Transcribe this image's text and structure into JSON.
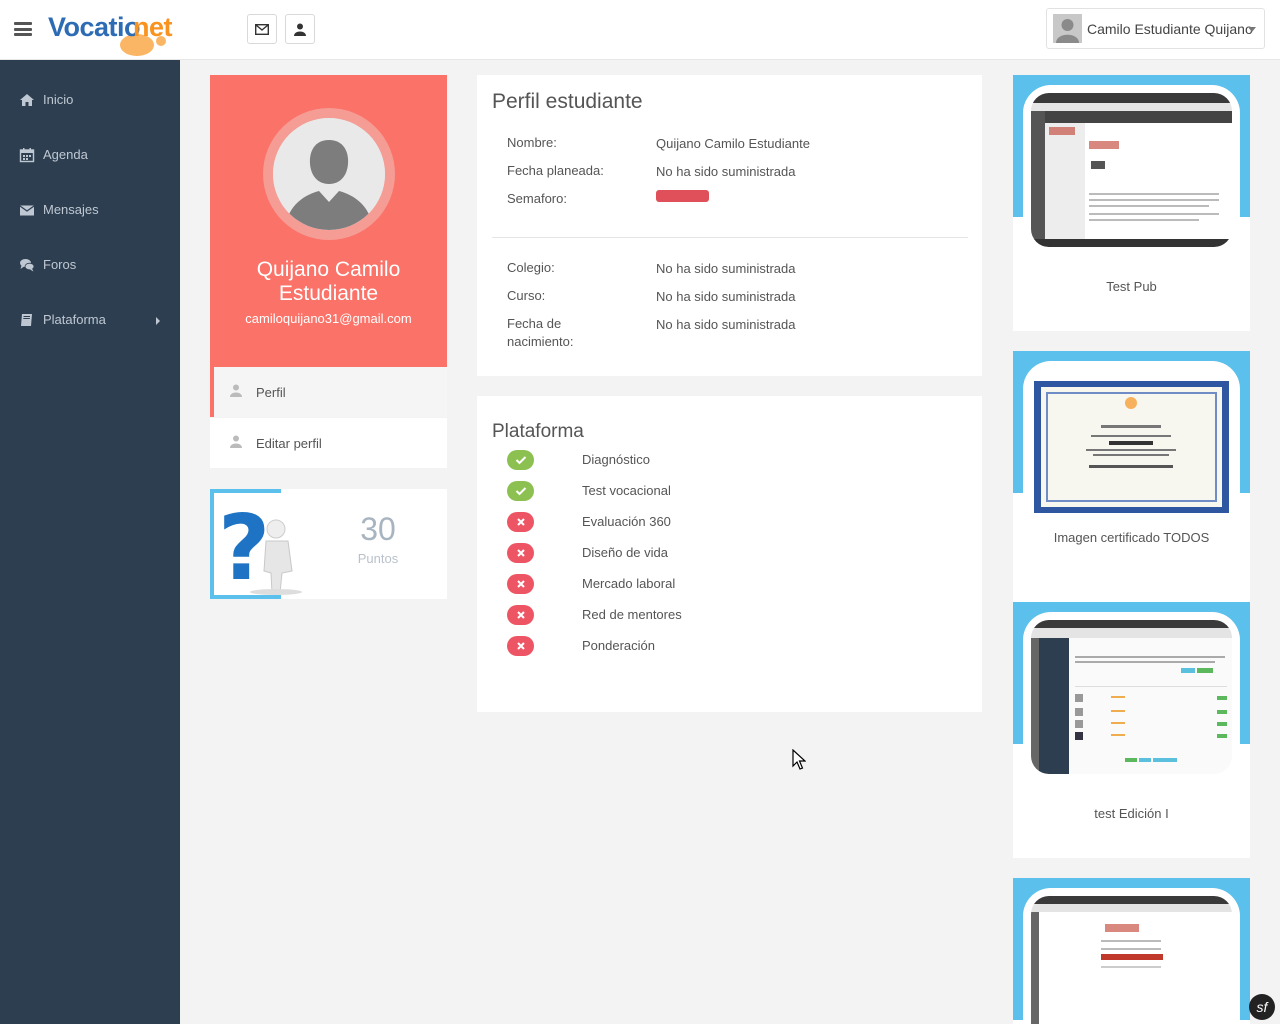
{
  "header": {
    "logo_part1": "Vocatio",
    "logo_part2": "net",
    "user_name": "Camilo Estudiante Quijano"
  },
  "sidebar": {
    "items": [
      {
        "label": "Inicio",
        "icon": "home-icon"
      },
      {
        "label": "Agenda",
        "icon": "calendar-icon"
      },
      {
        "label": "Mensajes",
        "icon": "envelope-icon"
      },
      {
        "label": "Foros",
        "icon": "comments-icon"
      },
      {
        "label": "Plataforma",
        "icon": "book-icon"
      }
    ]
  },
  "profile": {
    "name": "Quijano Camilo Estudiante",
    "email": "camiloquijano31@gmail.com",
    "menu": [
      {
        "label": "Perfil"
      },
      {
        "label": "Editar perfil"
      }
    ],
    "points_value": "30",
    "points_label": "Puntos"
  },
  "student": {
    "title": "Perfil estudiante",
    "rows": [
      {
        "label": "Nombre:",
        "value": "Quijano Camilo Estudiante"
      },
      {
        "label": "Fecha planeada:",
        "value": "No ha sido suministrada"
      },
      {
        "label": "Semaforo:",
        "value": ""
      },
      {
        "label": "Colegio:",
        "value": "No ha sido suministrada"
      },
      {
        "label": "Curso:",
        "value": "No ha sido suministrada"
      },
      {
        "label": "Fecha de nacimiento:",
        "value": "No ha sido suministrada"
      }
    ],
    "semaforo_color": "#e0505b"
  },
  "platform": {
    "title": "Plataforma",
    "steps": [
      {
        "label": "Diagnóstico",
        "status": "done"
      },
      {
        "label": "Test vocacional",
        "status": "done"
      },
      {
        "label": "Evaluación 360",
        "status": "pending"
      },
      {
        "label": "Diseño de vida",
        "status": "pending"
      },
      {
        "label": "Mercado laboral",
        "status": "pending"
      },
      {
        "label": "Red de mentores",
        "status": "pending"
      },
      {
        "label": "Ponderación",
        "status": "pending"
      }
    ]
  },
  "publications": [
    {
      "caption": "Test Pub"
    },
    {
      "caption": "Imagen certificado TODOS"
    },
    {
      "caption": "test Edición I"
    },
    {
      "caption": ""
    }
  ],
  "colors": {
    "sidebar_bg": "#2c3e50",
    "accent": "#fa7268",
    "card_band": "#5bc0eb",
    "ok": "#8cc152",
    "error": "#ed5565"
  }
}
